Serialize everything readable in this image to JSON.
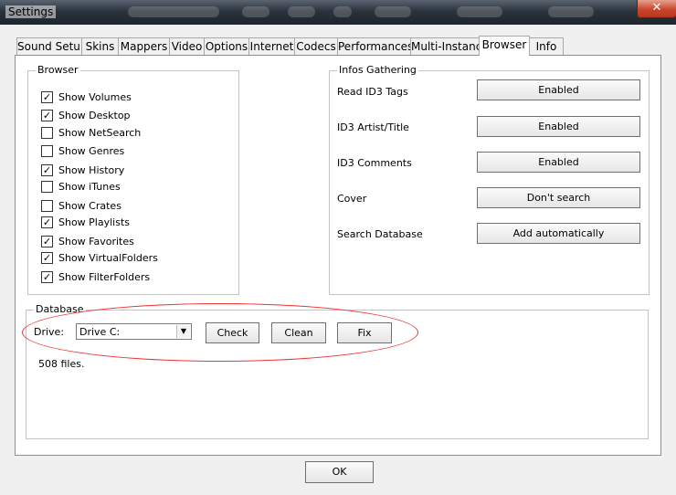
{
  "window": {
    "title": "Settings",
    "close_glyph": "✕"
  },
  "tabs": [
    {
      "label": "Sound Setup"
    },
    {
      "label": "Skins"
    },
    {
      "label": "Mappers"
    },
    {
      "label": "Video"
    },
    {
      "label": "Options"
    },
    {
      "label": "Internet"
    },
    {
      "label": "Codecs"
    },
    {
      "label": "Performances"
    },
    {
      "label": "Multi-Instance"
    },
    {
      "label": "Browser",
      "active": true
    },
    {
      "label": "Info"
    }
  ],
  "browser_group": {
    "title": "Browser",
    "items": [
      {
        "label": "Show Volumes",
        "checked": true
      },
      {
        "label": "Show Desktop",
        "checked": true
      },
      {
        "label": "Show NetSearch",
        "checked": false
      },
      {
        "label": "Show Genres",
        "checked": false
      },
      {
        "label": "Show History",
        "checked": true
      },
      {
        "label": "Show iTunes",
        "checked": false
      },
      {
        "label": "Show Crates",
        "checked": false
      },
      {
        "label": "Show Playlists",
        "checked": true
      },
      {
        "label": "Show Favorites",
        "checked": true
      },
      {
        "label": "Show VirtualFolders",
        "checked": true
      },
      {
        "label": "Show FilterFolders",
        "checked": true
      }
    ],
    "check_glyph": "✓"
  },
  "infos_group": {
    "title": "Infos Gathering",
    "rows": [
      {
        "label": "Read ID3 Tags",
        "value": "Enabled"
      },
      {
        "label": "ID3 Artist/Title",
        "value": "Enabled"
      },
      {
        "label": "ID3 Comments",
        "value": "Enabled"
      },
      {
        "label": "Cover",
        "value": "Don't search"
      },
      {
        "label": "Search Database",
        "value": "Add automatically"
      }
    ]
  },
  "database_group": {
    "title": "Database",
    "drive_label": "Drive:",
    "drive_value": "Drive C:",
    "check_label": "Check",
    "clean_label": "Clean",
    "fix_label": "Fix",
    "status": "508 files."
  },
  "footer": {
    "ok_label": "OK"
  },
  "colors": {
    "annotation": "#e33333"
  }
}
